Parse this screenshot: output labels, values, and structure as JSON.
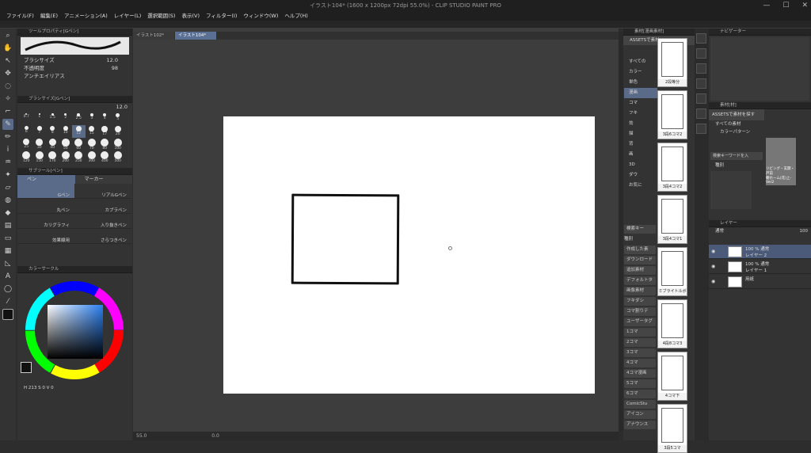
{
  "window": {
    "title": "イラスト104* (1600 x 1200px 72dpi 55.0%)  - CLIP STUDIO PAINT PRO",
    "controls": [
      "—",
      "☐",
      "✕"
    ]
  },
  "menu": [
    "ファイル(F)",
    "編集(E)",
    "アニメーション(A)",
    "レイヤー(L)",
    "選択範囲(S)",
    "表示(V)",
    "フィルター(I)",
    "ウィンドウ(W)",
    "ヘルプ(H)"
  ],
  "tabs": [
    {
      "label": "イラスト102*"
    },
    {
      "label": "イラスト104*"
    }
  ],
  "tool_property": {
    "header": "ツールプロパティ[Gペン]",
    "brush_size_label": "ブラシサイズ",
    "brush_size_value": "12.0",
    "opacity_label": "不透明度",
    "opacity_value": "98",
    "antialias_label": "アンチエイリアス"
  },
  "brush_size_palette": {
    "header": "ブラシサイズ[Gペン]",
    "value": "12.0",
    "sizes": [
      "0.7",
      "1",
      "1.5",
      "2",
      "2.5",
      "3",
      "4",
      "5",
      "6",
      "7",
      "8",
      "10",
      "12",
      "15",
      "17",
      "20",
      "25",
      "30",
      "40",
      "50",
      "60",
      "70",
      "80",
      "100",
      "120",
      "150",
      "170",
      "200",
      "250",
      "300",
      "400",
      "500"
    ],
    "selected": "12"
  },
  "subtool": {
    "header": "サブツール[ペン]",
    "tab1": "ペン",
    "tab2": "マーカー",
    "items": [
      "Gペン",
      "リアルGペン",
      "丸ペン",
      "カブラペン",
      "カリグラフィ",
      "入り抜きペン",
      "効果線用",
      "さらつきペン"
    ]
  },
  "color_circle": {
    "header": "カラーサークル",
    "h": "213",
    "s": "0",
    "v": "0"
  },
  "canvas": {
    "zoom": "55.0",
    "rotation": "0.0"
  },
  "materials": {
    "header": "素材[漫画素材]",
    "search_label": "ASSETSで素材",
    "tree": [
      "すべての",
      "カラー",
      "単色",
      "漫画",
      "コマ",
      "フキ",
      "効",
      "描",
      "背",
      "画",
      "3D",
      "ダウ",
      "お気に"
    ],
    "search_placeholder": "検索キー",
    "kind_label": "種別",
    "tags": [
      "作成した素",
      "ダウンロード",
      "追加素材",
      "デフォルトタ",
      "画像素材",
      "フキダシ",
      "コマ割りテ",
      "ユーザータグ",
      "1コマ",
      "2コマ",
      "3コマ",
      "4コマ",
      "4コマ漫画",
      "5コマ",
      "6コマ",
      "ComicStu",
      "アイコン",
      "アナウンス"
    ],
    "thumbs": [
      "2段等分",
      "3段6コマ2",
      "3段4コマ2",
      "3段4コマ1",
      "ミブライトルボ",
      "4段8コマ3",
      "4コマ下",
      "3段5コマ"
    ]
  },
  "navigator": {
    "header": "ナビゲーター"
  },
  "material2": {
    "header": "素材[材]",
    "assets_label": "ASSETSで素材を探す",
    "tree": [
      "すべての素材",
      "カラーパターン"
    ],
    "search_placeholder": "検索キーワードを入",
    "kind_label": "種別",
    "items": [
      "リビング・玄関・戸前",
      "朝ホーム(花)上-Ver2"
    ]
  },
  "layers": {
    "header": "レイヤー",
    "blend": "通常",
    "opacity": "100",
    "items": [
      {
        "line1": "100 % 通常",
        "line2": "レイヤー 2"
      },
      {
        "line1": "100 % 通常",
        "line2": "レイヤー 1"
      },
      {
        "line1": "",
        "line2": "用紙"
      }
    ]
  }
}
